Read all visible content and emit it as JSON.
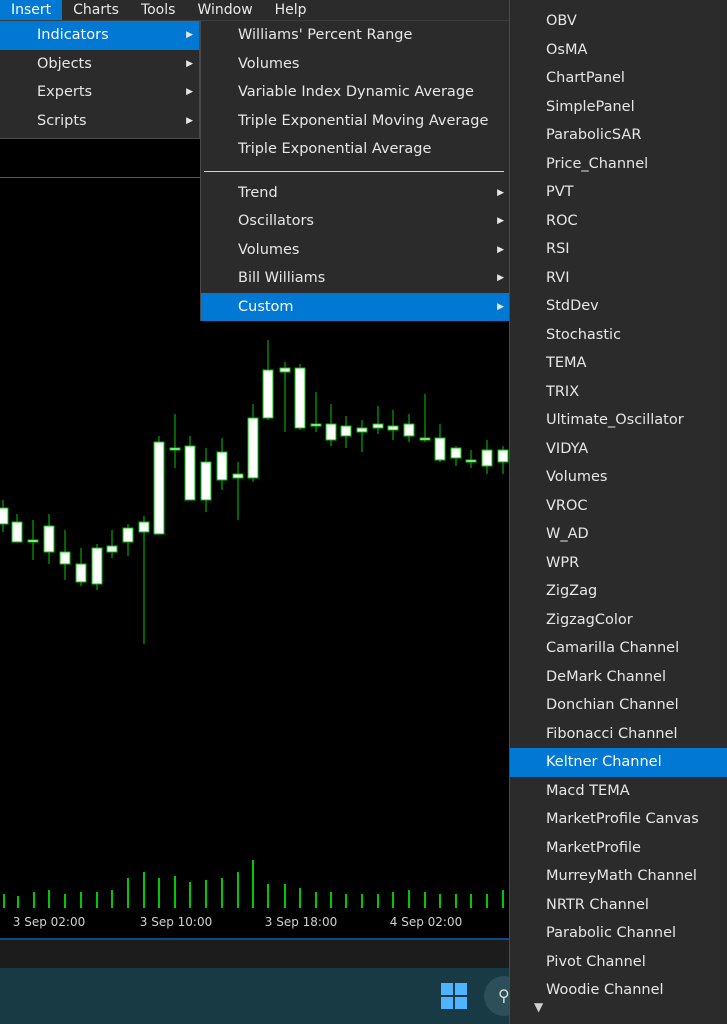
{
  "menubar": {
    "items": [
      "Insert",
      "Charts",
      "Tools",
      "Window",
      "Help"
    ]
  },
  "insert_menu": {
    "items": [
      {
        "label": "Indicators"
      },
      {
        "label": "Objects"
      },
      {
        "label": "Experts"
      },
      {
        "label": "Scripts"
      }
    ]
  },
  "indicators_menu": {
    "recent": [
      "Williams' Percent Range",
      "Volumes",
      "Variable Index Dynamic Average",
      "Triple Exponential Moving Average",
      "Triple Exponential Average"
    ],
    "groups": [
      "Trend",
      "Oscillators",
      "Volumes",
      "Bill Williams",
      "Custom"
    ]
  },
  "custom_menu": {
    "items": [
      "OBV",
      "OsMA",
      "ChartPanel",
      "SimplePanel",
      "ParabolicSAR",
      "Price_Channel",
      "PVT",
      "ROC",
      "RSI",
      "RVI",
      "StdDev",
      "Stochastic",
      "TEMA",
      "TRIX",
      "Ultimate_Oscillator",
      "VIDYA",
      "Volumes",
      "VROC",
      "W_AD",
      "WPR",
      "ZigZag",
      "ZigzagColor",
      "Camarilla Channel",
      "DeMark Channel",
      "Donchian Channel",
      "Fibonacci Channel",
      "Keltner Channel",
      "Macd TEMA",
      "MarketProfile Canvas",
      "MarketProfile",
      "MurreyMath Channel",
      "NRTR Channel",
      "Parabolic Channel",
      "Pivot Channel",
      "Woodie Channel"
    ],
    "highlighted": "Keltner Channel"
  },
  "chart": {
    "time_labels": [
      "3 Sep 02:00",
      "3 Sep 10:00",
      "3 Sep 18:00",
      "4 Sep 02:00"
    ],
    "candle_color": "#00c800",
    "bull_body_color": "#000000",
    "bear_body_color": "#ffffff"
  },
  "colors": {
    "accent": "#0078d4",
    "menu_bg": "#2b2b2b"
  },
  "icons": {
    "submenu": "chevron-right-icon",
    "scroll": "chevron-down-icon",
    "windows": "windows-logo-icon",
    "search": "search-icon"
  }
}
